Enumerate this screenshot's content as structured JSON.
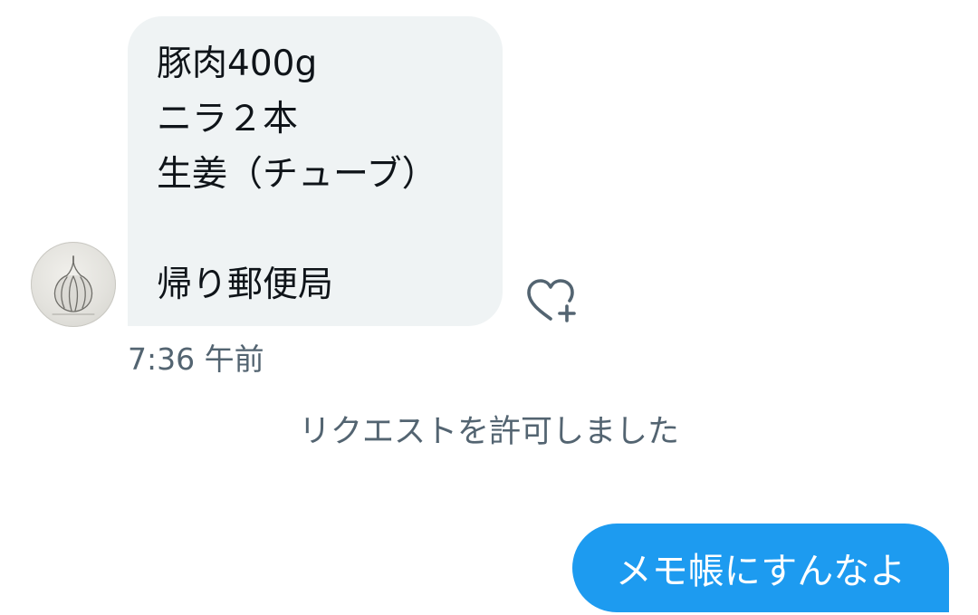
{
  "conversation": {
    "incoming": {
      "lines": [
        "豚肉400g",
        "ニラ２本",
        "生姜（チューブ）",
        "",
        "帰り郵便局"
      ],
      "timestamp": "7:36 午前",
      "bubble_color": "#eff3f4",
      "text_color": "#0f1419"
    },
    "system_notice": "リクエストを許可しました",
    "outgoing": {
      "text": "メモ帳にすんなよ",
      "bubble_color": "#1d9bf0",
      "text_color": "#ffffff"
    },
    "react_icon": "heart-plus-icon",
    "avatar_icon": "garlic-avatar-icon",
    "secondary_text_color": "#536471"
  }
}
